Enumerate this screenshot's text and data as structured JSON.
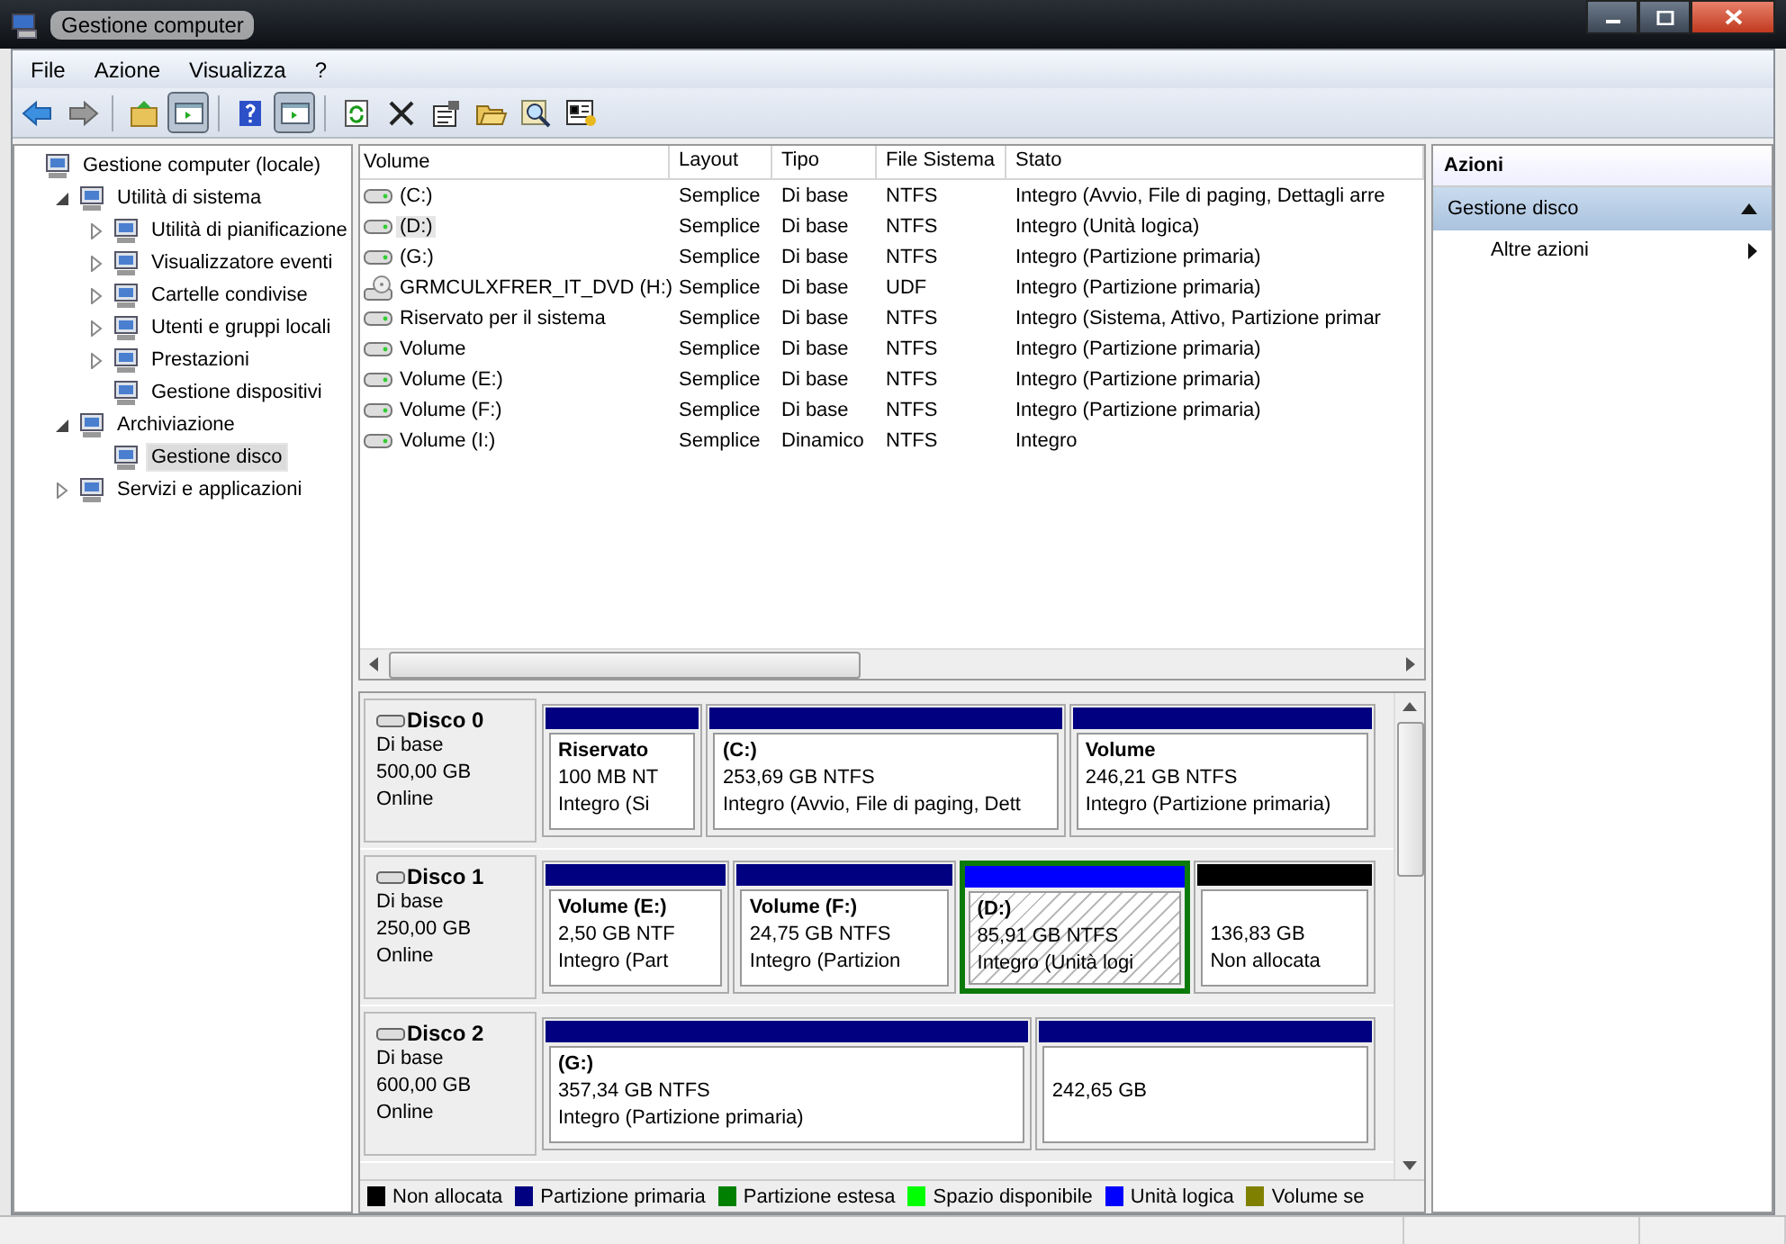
{
  "window": {
    "title": "Gestione computer"
  },
  "menu": [
    "File",
    "Azione",
    "Visualizza",
    "?"
  ],
  "toolbar": [
    [
      {
        "kind": "back",
        "pressed": false
      },
      {
        "kind": "forward",
        "pressed": false
      }
    ],
    [
      {
        "kind": "up",
        "pressed": false
      },
      {
        "kind": "pane",
        "pressed": true
      }
    ],
    [
      {
        "kind": "help",
        "pressed": false
      },
      {
        "kind": "pane",
        "pressed": true
      }
    ],
    [
      {
        "kind": "refresh",
        "pressed": false
      },
      {
        "kind": "delete",
        "pressed": false
      },
      {
        "kind": "properties",
        "pressed": false
      },
      {
        "kind": "open",
        "pressed": false
      },
      {
        "kind": "find",
        "pressed": false
      },
      {
        "kind": "console",
        "pressed": false
      }
    ]
  ],
  "tree": [
    {
      "label": "Gestione computer (locale)",
      "kind": "root",
      "selected": false,
      "children": [
        {
          "label": "Utilità di sistema",
          "kind": "branch",
          "expanded": true,
          "selected": false,
          "children": [
            {
              "label": "Utilità di pianificazione",
              "kind": "branch",
              "expanded": false,
              "selected": false
            },
            {
              "label": "Visualizzatore eventi",
              "kind": "branch",
              "expanded": false,
              "selected": false
            },
            {
              "label": "Cartelle condivise",
              "kind": "branch",
              "expanded": false,
              "selected": false
            },
            {
              "label": "Utenti e gruppi locali",
              "kind": "branch",
              "expanded": false,
              "selected": false
            },
            {
              "label": "Prestazioni",
              "kind": "branch",
              "expanded": false,
              "selected": false
            },
            {
              "label": "Gestione dispositivi",
              "kind": "leaf",
              "expanded": false,
              "selected": false
            }
          ]
        },
        {
          "label": "Archiviazione",
          "kind": "branch",
          "expanded": true,
          "selected": false,
          "children": [
            {
              "label": "Gestione disco",
              "kind": "leaf",
              "expanded": false,
              "selected": true
            }
          ]
        },
        {
          "label": "Servizi e applicazioni",
          "kind": "branch",
          "expanded": false,
          "selected": false
        }
      ]
    }
  ],
  "volumes": {
    "columns": [
      "Volume",
      "Layout",
      "Tipo",
      "File Sistema",
      "Stato"
    ],
    "rows": [
      {
        "kind": "disk",
        "cells": [
          "(C:)",
          "Semplice",
          "Di base",
          "NTFS",
          "Integro (Avvio, File di paging, Dettagli arre"
        ],
        "selected": false
      },
      {
        "kind": "disk",
        "cells": [
          "(D:)",
          "Semplice",
          "Di base",
          "NTFS",
          "Integro (Unità logica)"
        ],
        "selected": true
      },
      {
        "kind": "disk",
        "cells": [
          "(G:)",
          "Semplice",
          "Di base",
          "NTFS",
          "Integro (Partizione primaria)"
        ],
        "selected": false
      },
      {
        "kind": "dvd",
        "cells": [
          "GRMCULXFRER_IT_DVD (H:)",
          "Semplice",
          "Di base",
          "UDF",
          "Integro (Partizione primaria)"
        ],
        "selected": false
      },
      {
        "kind": "disk",
        "cells": [
          "Riservato per il sistema",
          "Semplice",
          "Di base",
          "NTFS",
          "Integro (Sistema, Attivo, Partizione primar"
        ],
        "selected": false
      },
      {
        "kind": "disk",
        "cells": [
          "Volume",
          "Semplice",
          "Di base",
          "NTFS",
          "Integro (Partizione primaria)"
        ],
        "selected": false
      },
      {
        "kind": "disk",
        "cells": [
          "Volume (E:)",
          "Semplice",
          "Di base",
          "NTFS",
          "Integro (Partizione primaria)"
        ],
        "selected": false
      },
      {
        "kind": "disk",
        "cells": [
          "Volume (F:)",
          "Semplice",
          "Di base",
          "NTFS",
          "Integro (Partizione primaria)"
        ],
        "selected": false
      },
      {
        "kind": "disk",
        "cells": [
          "Volume (I:)",
          "Semplice",
          "Dinamico",
          "NTFS",
          "Integro"
        ],
        "selected": false
      }
    ]
  },
  "disks": [
    {
      "name": "Disco 0",
      "type": "Di base",
      "size": "500,00 GB",
      "state": "Online",
      "partitions": [
        {
          "kind": "primary",
          "name": "Riservato",
          "size": "100 MB NT",
          "status": "Integro (Si",
          "selected": false
        },
        {
          "kind": "primary",
          "name": "(C:)",
          "size": "253,69 GB NTFS",
          "status": "Integro (Avvio, File di paging, Dett",
          "selected": false
        },
        {
          "kind": "primary",
          "name": "Volume",
          "size": "246,21 GB NTFS",
          "status": "Integro (Partizione primaria)",
          "selected": false
        }
      ]
    },
    {
      "name": "Disco 1",
      "type": "Di base",
      "size": "250,00 GB",
      "state": "Online",
      "partitions": [
        {
          "kind": "primary",
          "name": "Volume  (E:)",
          "size": "2,50 GB NTF",
          "status": "Integro (Part",
          "selected": false
        },
        {
          "kind": "primary",
          "name": "Volume  (F:)",
          "size": "24,75 GB NTFS",
          "status": "Integro (Partizion",
          "selected": false
        },
        {
          "kind": "logical",
          "name": "(D:)",
          "size": "85,91 GB NTFS",
          "status": "Integro (Unità logi",
          "selected": true
        },
        {
          "kind": "unallocated",
          "size": "136,83 GB",
          "status": "Non allocata",
          "selected": false
        }
      ]
    },
    {
      "name": "Disco 2",
      "type": "Di base",
      "size": "600,00 GB",
      "state": "Online",
      "partitions": [
        {
          "kind": "primary",
          "name": "(G:)",
          "size": "357,34 GB NTFS",
          "status": "Integro (Partizione primaria)",
          "selected": false
        },
        {
          "kind": "primary",
          "size": "242,65 GB",
          "selected": false
        }
      ]
    }
  ],
  "legend": [
    {
      "label": "Non allocata",
      "color": "#000000"
    },
    {
      "label": "Partizione primaria",
      "color": "#000080"
    },
    {
      "label": "Partizione estesa",
      "color": "#008000"
    },
    {
      "label": "Spazio disponibile",
      "color": "#00ff00"
    },
    {
      "label": "Unità logica",
      "color": "#0000ff"
    },
    {
      "label": "Volume se",
      "color": "#808000"
    }
  ],
  "actions": {
    "title": "Azioni",
    "sections": [
      {
        "label": "Gestione disco",
        "expanded": true,
        "items": [
          "Altre azioni"
        ]
      }
    ]
  }
}
